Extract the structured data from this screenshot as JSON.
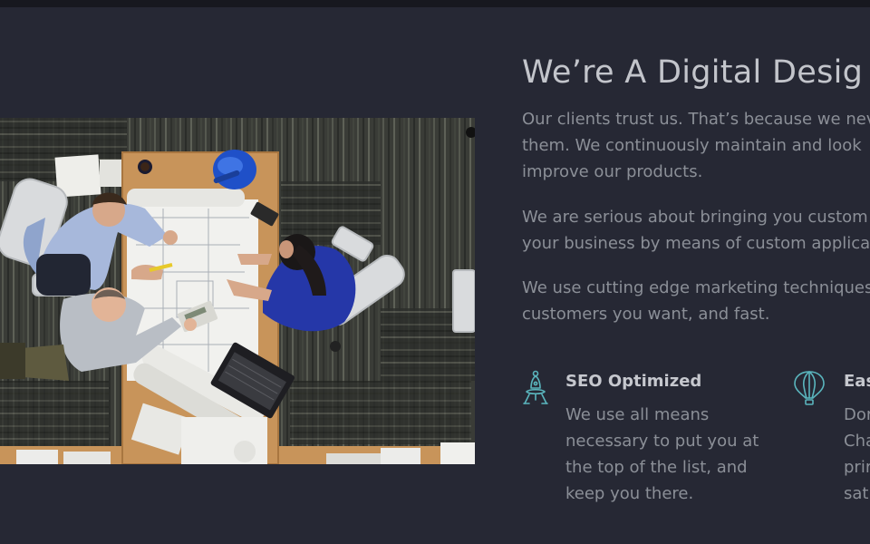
{
  "hero": {
    "image_alt": "Overhead view of a team working on architectural plans at a desk"
  },
  "headline": "We’re A Digital Desig",
  "paragraphs": [
    [
      "Our clients trust us. That’s because we nev",
      "them. We continuously maintain and look",
      "improve our products."
    ],
    [
      "We are serious about bringing you custom",
      "your business by means of custom applica"
    ],
    [
      "We use cutting edge marketing techniques",
      "customers you want, and fast."
    ]
  ],
  "features": [
    {
      "icon": "rocket-launch-icon",
      "title": "SEO Optimized",
      "text": [
        "We use all means",
        "necessary to put you at",
        "the top of the list, and",
        "keep you there."
      ]
    },
    {
      "icon": "hot-air-balloon-icon",
      "title": "Eas",
      "text": [
        "Dor",
        "Cha",
        "prir",
        "sati"
      ]
    }
  ],
  "colors": {
    "background": "#262834",
    "topbar": "#17181f",
    "heading": "#c3c5cb",
    "body_text": "#8b8f97",
    "icon": "#5ab5bd"
  }
}
